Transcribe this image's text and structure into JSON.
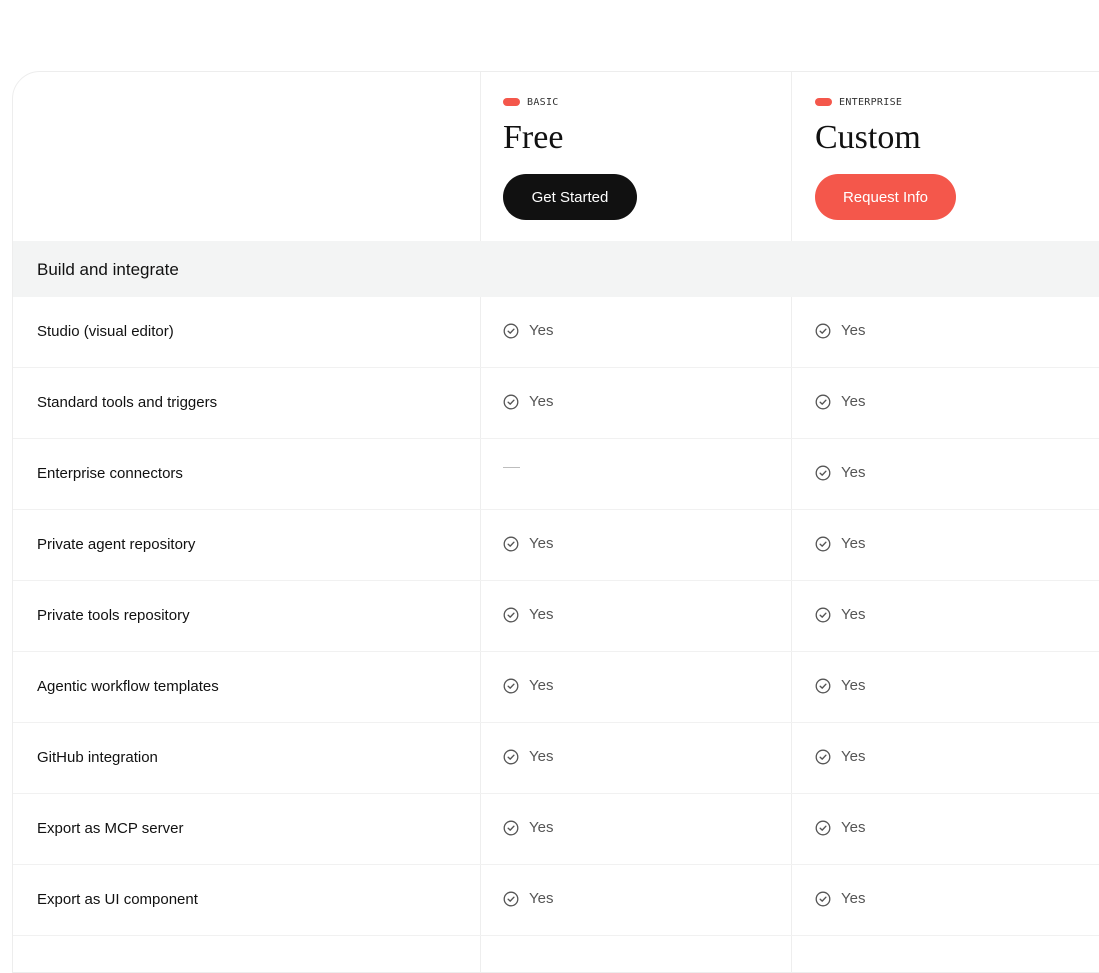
{
  "plans": [
    {
      "tag": "BASIC",
      "price": "Free",
      "cta": "Get Started"
    },
    {
      "tag": "ENTERPRISE",
      "price": "Custom",
      "cta": "Request Info"
    }
  ],
  "colors": {
    "accent": "#f4574b",
    "dark_button": "#111111",
    "section_bg": "#f3f4f4"
  },
  "section": {
    "title": "Build and integrate"
  },
  "features": [
    {
      "name": "Studio (visual editor)",
      "basic": "Yes",
      "enterprise": "Yes"
    },
    {
      "name": "Standard tools and triggers",
      "basic": "Yes",
      "enterprise": "Yes"
    },
    {
      "name": "Enterprise connectors",
      "basic": "",
      "enterprise": "Yes"
    },
    {
      "name": "Private agent repository",
      "basic": "Yes",
      "enterprise": "Yes"
    },
    {
      "name": "Private tools repository",
      "basic": "Yes",
      "enterprise": "Yes"
    },
    {
      "name": "Agentic workflow templates",
      "basic": "Yes",
      "enterprise": "Yes"
    },
    {
      "name": "GitHub integration",
      "basic": "Yes",
      "enterprise": "Yes"
    },
    {
      "name": "Export as MCP server",
      "basic": "Yes",
      "enterprise": "Yes"
    },
    {
      "name": "Export as UI component",
      "basic": "Yes",
      "enterprise": "Yes"
    }
  ],
  "icons": {
    "included": "check-circle-icon",
    "not_included": "dash-icon"
  }
}
